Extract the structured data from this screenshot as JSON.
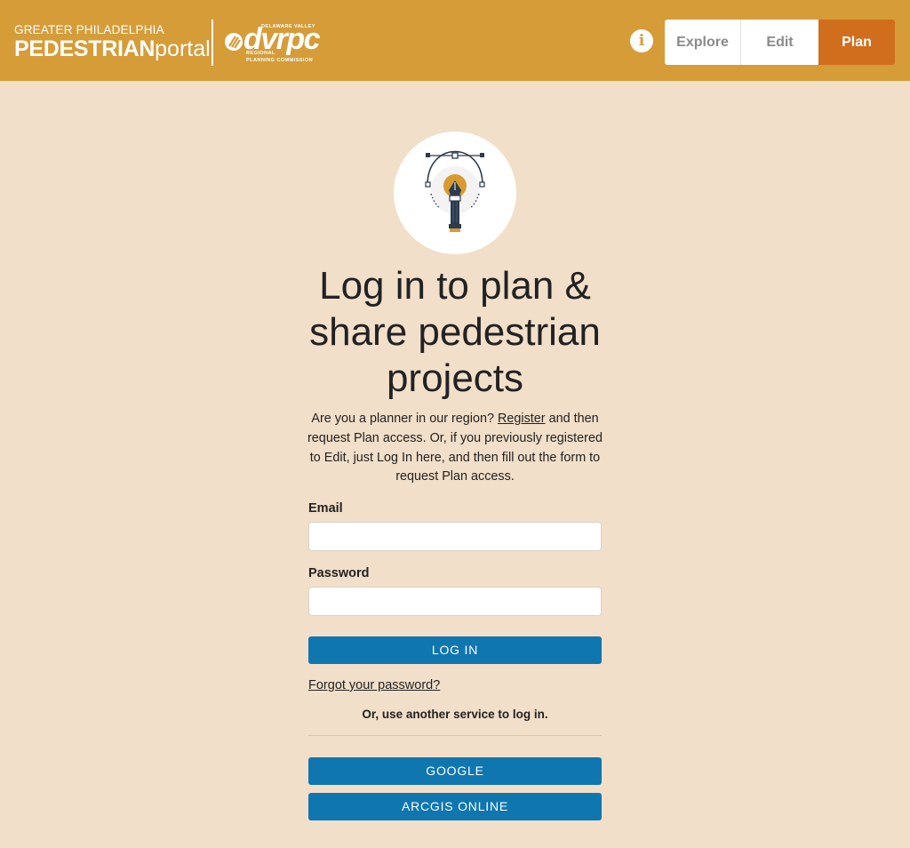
{
  "header": {
    "brand_top": "GREATER PHILADELPHIA",
    "brand_bold": "PEDESTRIAN",
    "brand_light": "portal",
    "dvrpc_name": "dvrpc",
    "dvrpc_line1": "DELAWARE VALLEY",
    "dvrpc_line2": "REGIONAL",
    "dvrpc_line3": "PLANNING COMMISSION",
    "info_icon": "i",
    "tabs": [
      {
        "label": "Explore",
        "active": false
      },
      {
        "label": "Edit",
        "active": false
      },
      {
        "label": "Plan",
        "active": true
      }
    ]
  },
  "hero_icon": "pen-tool-icon",
  "title": "Log in to plan & share pedestrian projects",
  "description": {
    "part1": "Are you a planner in our region? ",
    "register_link": "Register",
    "part2": " and then request Plan access. Or, if you previously registered to Edit, just Log In here, and then fill out the form to request Plan access."
  },
  "form": {
    "email_label": "Email",
    "email_value": "",
    "password_label": "Password",
    "password_value": "",
    "login_button": "LOG IN",
    "forgot_link": "Forgot your password?",
    "alt_text": "Or, use another service to log in.",
    "google_button": "GOOGLE",
    "arcgis_button": "ARCGIS ONLINE"
  },
  "colors": {
    "header_bg": "#d59c38",
    "page_bg": "#f2dfc9",
    "plan_tab": "#d06e1e",
    "button_blue": "#0f76b0"
  }
}
